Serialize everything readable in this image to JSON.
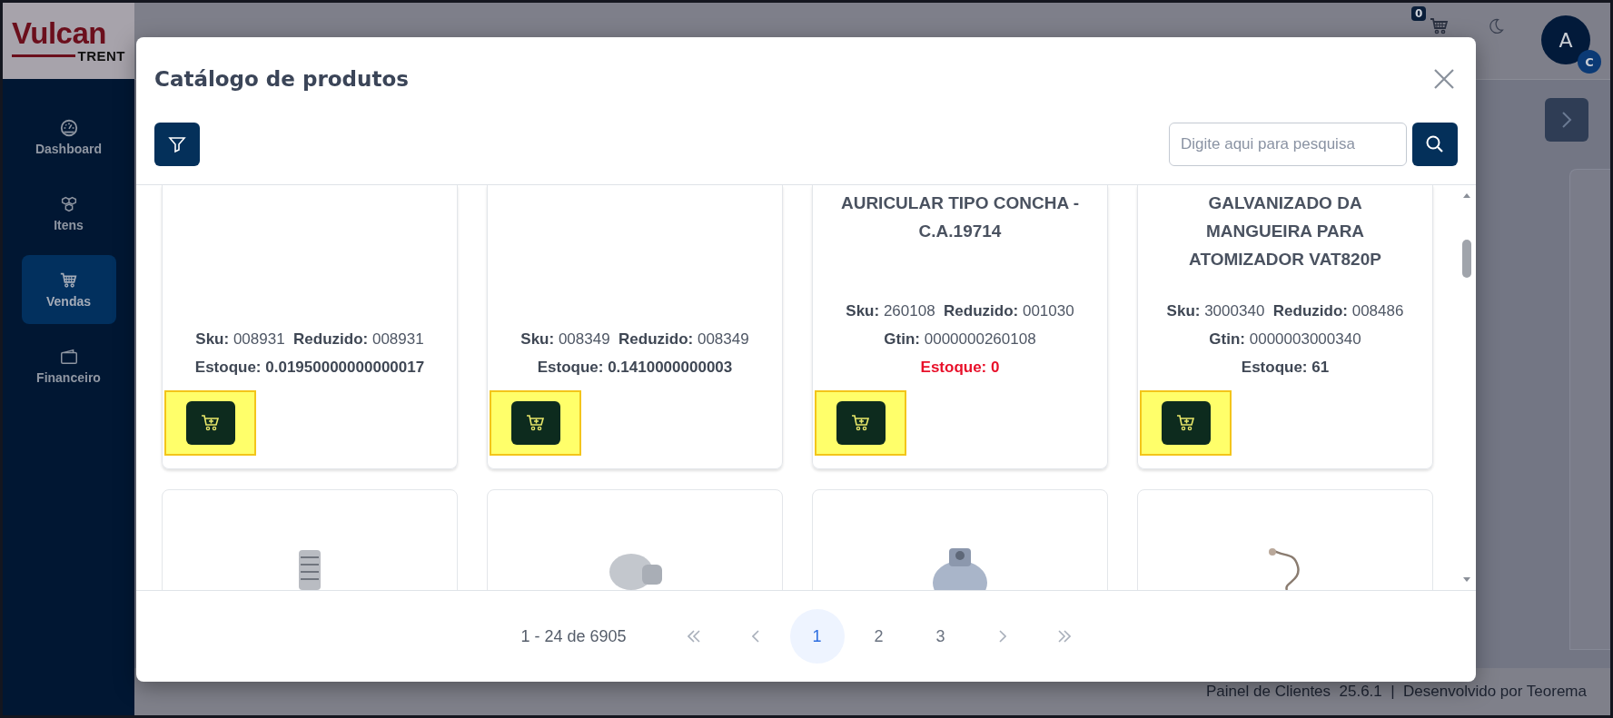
{
  "logo": {
    "name": "Vulcan",
    "sub": "TRENT"
  },
  "sidebar": {
    "items": [
      {
        "label": "Dashboard",
        "selected": false
      },
      {
        "label": "Itens",
        "selected": false
      },
      {
        "label": "Vendas",
        "selected": true
      },
      {
        "label": "Financeiro",
        "selected": false
      }
    ]
  },
  "header": {
    "cart_count": "0",
    "avatar": "A",
    "avatar_badge": "C"
  },
  "footer": "Painel de Clientes  25.6.1  |  Desenvolvido por Teorema",
  "modal": {
    "title": "Catálogo de produtos",
    "search": {
      "placeholder": "Digite aqui para pesquisa"
    },
    "products": [
      {
        "info": [
          "**Sku:** 008931  **Reduzido:** 008931"
        ],
        "stock": "Estoque: 0.01950000000000017",
        "stock_alert": false
      },
      {
        "info": [
          "**Sku:** 008349  **Reduzido:** 008349"
        ],
        "stock": "Estoque: 0.1410000000003",
        "stock_alert": false
      },
      {
        "title": "AURICULAR TIPO CONCHA - C.A.19714",
        "info": [
          "**Sku:** 260108  **Reduzido:** 001030",
          "**Gtin:** 0000000260108"
        ],
        "stock": "Estoque: 0",
        "stock_alert": true
      },
      {
        "title": "GALVANIZADO DA MANGUEIRA PARA ATOMIZADOR VAT820P",
        "info": [
          "**Sku:** 3000340  **Reduzido:** 008486",
          "**Gtin:** 0000003000340"
        ],
        "stock": "Estoque: 61",
        "stock_alert": false
      }
    ],
    "pagination": {
      "range": "1 - 24 de 6905",
      "pages": [
        {
          "label": "1",
          "selected": true
        },
        {
          "label": "2",
          "selected": false
        },
        {
          "label": "3",
          "selected": false
        }
      ]
    }
  }
}
